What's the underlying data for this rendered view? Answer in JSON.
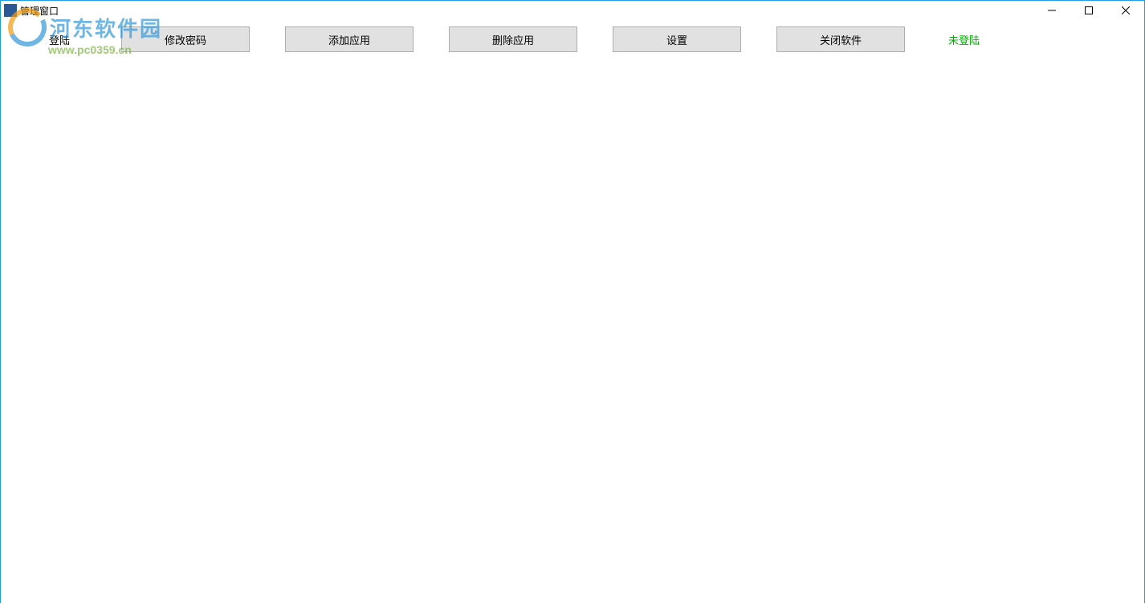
{
  "window": {
    "title": "管理窗口"
  },
  "toolbar": {
    "login_label": "登陆",
    "buttons": [
      {
        "label": "修改密码"
      },
      {
        "label": "添加应用"
      },
      {
        "label": "删除应用"
      },
      {
        "label": "设置"
      },
      {
        "label": "关闭软件"
      }
    ],
    "status_label": "未登陆"
  },
  "watermark": {
    "text": "河东软件园",
    "url": "www.pc0359.cn"
  }
}
